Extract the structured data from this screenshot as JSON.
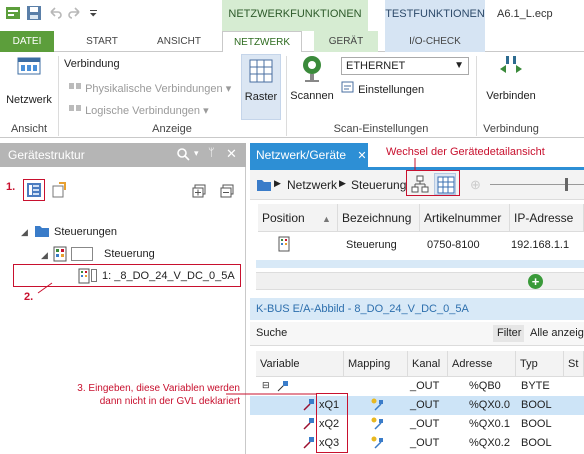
{
  "titlebar": {
    "ctx_network_group": "NETZWERKFUNKTIONEN",
    "ctx_test_group": "TESTFUNKTIONEN",
    "file_title": "A6.1_L.ecp"
  },
  "tabs": {
    "datei": "DATEI",
    "start": "START",
    "ansicht": "ANSICHT",
    "netzwerk": "NETZWERK",
    "geraet": "GERÄT",
    "iocheck": "I/O-CHECK"
  },
  "ribbon": {
    "netzwerk_btn": "Netzwerk",
    "verbindung": "Verbindung",
    "phys_verbindungen": "Physikalische Verbindungen",
    "log_verbindungen": "Logische Verbindungen",
    "raster_btn": "Raster",
    "scannen_btn": "Scannen",
    "interface_value": "ETHERNET",
    "einstellungen": "Einstellungen",
    "verbinden_btn": "Verbinden",
    "group_ansicht": "Ansicht",
    "group_anzeige": "Anzeige",
    "group_scan": "Scan-Einstellungen",
    "group_verbindung": "Verbindung"
  },
  "left_panel": {
    "title": "Gerätestruktur",
    "tree_root": "Steuerungen",
    "tree_controller": "Steuerung",
    "tree_module": "1: _8_DO_24_V_DC_0_5A"
  },
  "right_panel": {
    "tab_title": "Netzwerk/Geräte",
    "breadcrumb_netzwerk": "Netzwerk",
    "breadcrumb_steuerung": "Steuerung",
    "columns": [
      "Position",
      "Bezeichnung",
      "Artikelnummer",
      "IP-Adresse"
    ],
    "row": {
      "bezeichnung": "Steuerung",
      "artikelnummer": "0750-8100",
      "ip": "192.168.1.1"
    },
    "kbus_title": "K-BUS E/A-Abbild - 8_DO_24_V_DC_0_5A",
    "suche": "Suche",
    "filter": "Filter",
    "filter_value": "Alle anzeigen",
    "var_columns": [
      "Variable",
      "Mapping",
      "Kanal",
      "Adresse",
      "Typ",
      "St"
    ],
    "var_rows": [
      {
        "variable": "",
        "kanal": "_OUT",
        "adresse": "%QB0",
        "typ": "BYTE"
      },
      {
        "variable": "xQ1",
        "kanal": "_OUT",
        "adresse": "%QX0.0",
        "typ": "BOOL"
      },
      {
        "variable": "xQ2",
        "kanal": "_OUT",
        "adresse": "%QX0.1",
        "typ": "BOOL"
      },
      {
        "variable": "xQ3",
        "kanal": "_OUT",
        "adresse": "%QX0.2",
        "typ": "BOOL"
      }
    ]
  },
  "annotations": {
    "step1": "1.",
    "step2": "2.",
    "step3": "3. Eingeben, diese Variablen werden",
    "step3_line2": "dann nicht in der GVL deklariert",
    "wechsel": "Wechsel der Gerätedetailansicht"
  },
  "colors": {
    "accent_green": "#5c9e3b",
    "accent_blue": "#2d8fd5",
    "annotation_red": "#c8102e"
  }
}
